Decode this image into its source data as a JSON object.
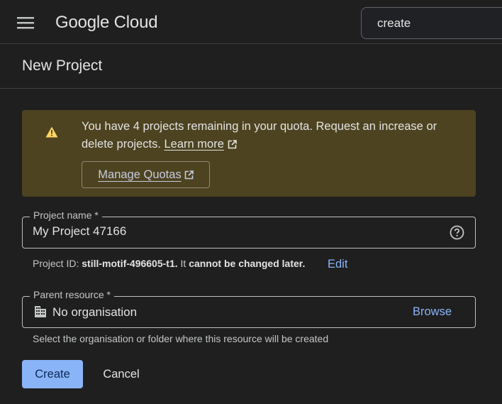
{
  "header": {
    "brand": "Google Cloud",
    "search_value": "create"
  },
  "page": {
    "title": "New Project"
  },
  "banner": {
    "message": "You have 4 projects remaining in your quota. Request an increase or delete projects.",
    "learn_more": "Learn more",
    "manage_quotas": "Manage Quotas"
  },
  "project_name": {
    "label": "Project name *",
    "value": "My Project 47166"
  },
  "project_id": {
    "prefix": "Project ID:",
    "id": "still-motif-496605-t1.",
    "middle": "It",
    "note": "cannot be changed later.",
    "edit": "Edit"
  },
  "parent_resource": {
    "label": "Parent resource *",
    "value": "No organisation",
    "browse": "Browse",
    "hint": "Select the organisation or folder where this resource will be created"
  },
  "actions": {
    "create": "Create",
    "cancel": "Cancel"
  },
  "colors": {
    "accent": "#8ab4f8",
    "warning": "#fdd663",
    "banner_bg": "#4d4320",
    "background": "#1f1f1f"
  },
  "icons": [
    "menu-icon",
    "warning-icon",
    "external-link-icon",
    "help-icon",
    "organisation-icon"
  ]
}
